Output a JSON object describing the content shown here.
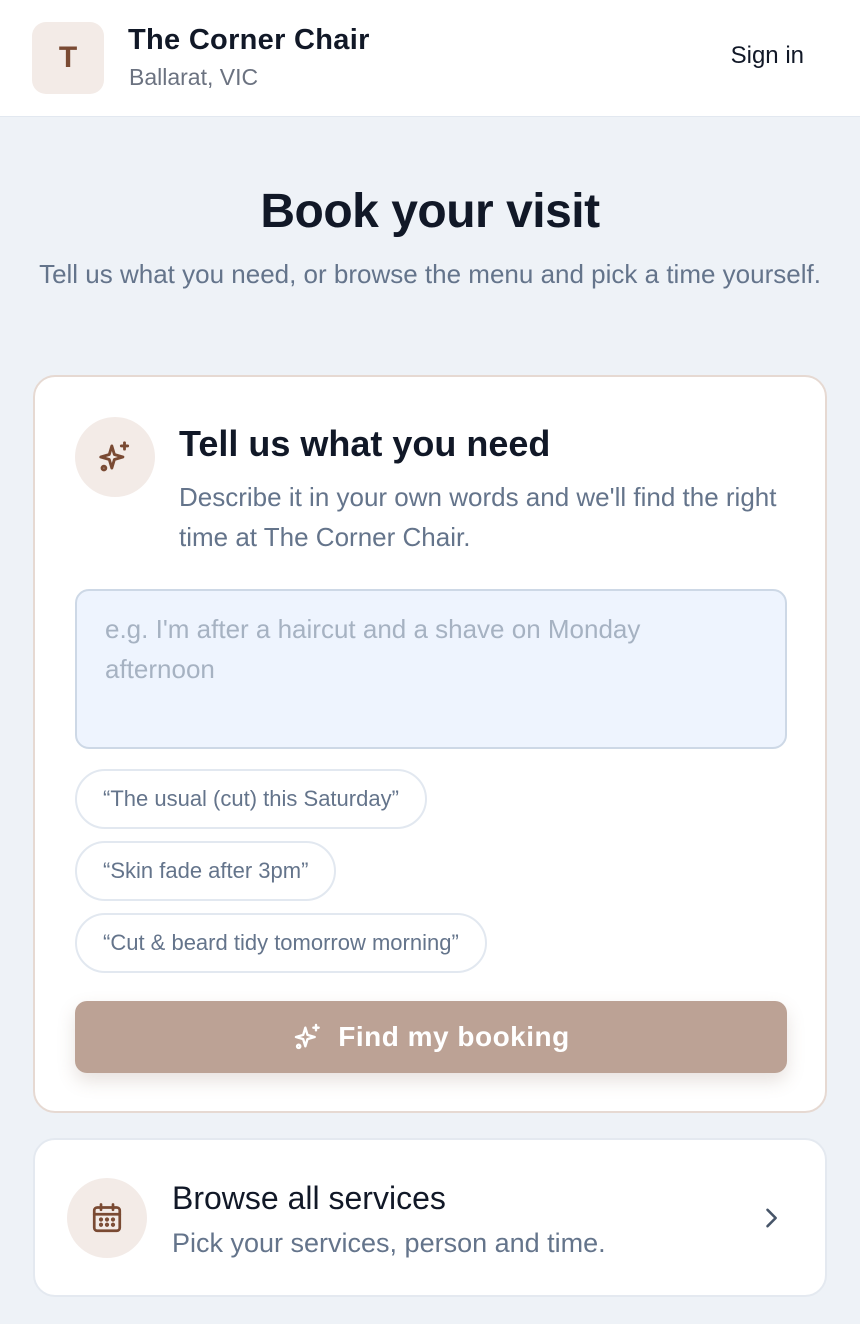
{
  "header": {
    "logo_letter": "T",
    "shop_name": "The Corner Chair",
    "location": "Ballarat, VIC",
    "sign_in_label": "Sign in"
  },
  "page": {
    "title": "Book your visit",
    "subtitle": "Tell us what you need, or browse the menu and pick a time yourself."
  },
  "ai_card": {
    "icon": "sparkles-icon",
    "title": "Tell us what you need",
    "description": "Describe it in your own words and we'll find the right time at The Corner Chair.",
    "input_value": "",
    "input_placeholder": "e.g. I'm after a haircut and a shave on Monday afternoon",
    "suggestions": [
      "“The usual (cut) this Saturday”",
      "“Skin fade after 3pm”",
      "“Cut & beard tidy tomorrow morning”"
    ],
    "button_label": "Find my booking",
    "button_icon": "sparkles-icon"
  },
  "browse_card": {
    "icon": "calendar-icon",
    "title": "Browse all services",
    "description": "Pick your services, person and time.",
    "chevron_icon": "chevron-right-icon"
  },
  "colors": {
    "accent": "#7a4a33",
    "accent_soft": "#f3ebe7",
    "button": "#bca295",
    "background": "#eef2f7",
    "muted_text": "#64748b"
  }
}
